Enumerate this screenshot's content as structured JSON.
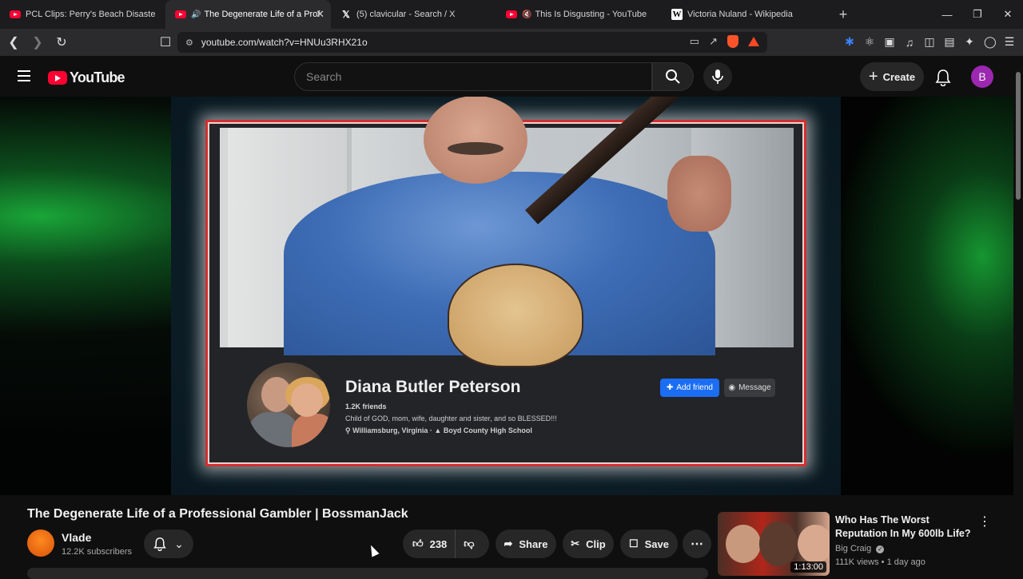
{
  "browser": {
    "tabs": [
      {
        "title": "PCL Clips: Perry's Beach Disaster - Yo",
        "icon": "youtube-icon",
        "audio": false
      },
      {
        "title": "The Degenerate Life of a Prof",
        "icon": "youtube-icon",
        "audio": true,
        "active": true
      },
      {
        "title": "(5) clavicular - Search / X",
        "icon": "x-icon",
        "audio": false
      },
      {
        "title": "This Is Disgusting - YouTube",
        "icon": "youtube-icon",
        "audio": true
      },
      {
        "title": "Victoria Nuland - Wikipedia",
        "icon": "wikipedia-icon",
        "audio": false
      }
    ],
    "url": "youtube.com/watch?v=HNUu3RHX21o"
  },
  "youtube": {
    "logo_text": "YouTube",
    "search_placeholder": "Search",
    "create_label": "Create",
    "avatar_letter": "B"
  },
  "video_content": {
    "profile_name": "Diana Butler Peterson",
    "friends": "1.2K friends",
    "bio": "Child of GOD, mom, wife, daughter and sister, and so BLESSED!!!",
    "location": "Williamsburg, Virginia · ",
    "school": "Boyd County High School",
    "add_friend_label": "Add friend",
    "message_label": "Message"
  },
  "video": {
    "title": "The Degenerate Life of a Professional Gambler | BossmanJack",
    "channel": "Vlade",
    "subscribers": "12.2K subscribers",
    "likes": "238",
    "share_label": "Share",
    "clip_label": "Clip",
    "save_label": "Save"
  },
  "recommended": [
    {
      "title": "Who Has The Worst Reputation In My 600lb Life?",
      "channel": "Big Craig",
      "verified": true,
      "views": "111K views",
      "age": "1 day ago",
      "meta": "111K views • 1 day ago",
      "duration": "1:13:00"
    }
  ],
  "colors": {
    "accent": "#ff0033",
    "frame_border": "#d0302f",
    "facebook_blue": "#1b6ef3",
    "avatar": "#9c27b0"
  }
}
